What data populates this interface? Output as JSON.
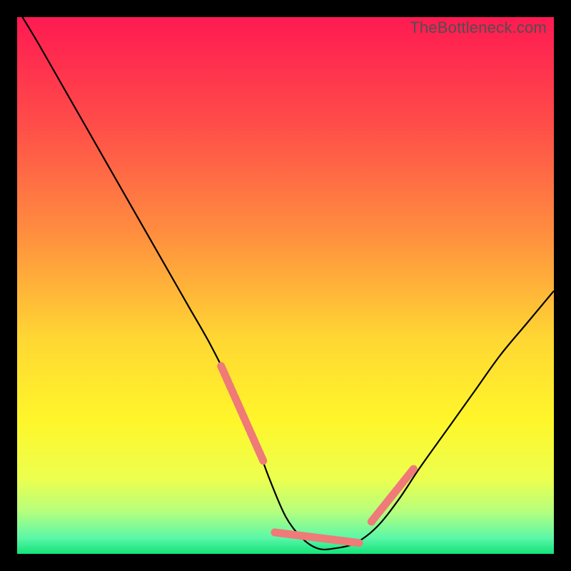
{
  "watermark": "TheBottleneck.com",
  "chart_data": {
    "type": "line",
    "title": "",
    "xlabel": "",
    "ylabel": "",
    "xlim": [
      0,
      100
    ],
    "ylim": [
      0,
      100
    ],
    "grid": false,
    "legend": false,
    "gradient_stops": [
      {
        "offset": 0.0,
        "color": "#ff1a52"
      },
      {
        "offset": 0.2,
        "color": "#ff4d49"
      },
      {
        "offset": 0.4,
        "color": "#ff8d3f"
      },
      {
        "offset": 0.6,
        "color": "#ffd733"
      },
      {
        "offset": 0.75,
        "color": "#fff62a"
      },
      {
        "offset": 0.86,
        "color": "#ecff4e"
      },
      {
        "offset": 0.92,
        "color": "#b7ff7c"
      },
      {
        "offset": 0.97,
        "color": "#5cf7a8"
      },
      {
        "offset": 1.0,
        "color": "#12e37a"
      }
    ],
    "series": [
      {
        "name": "bottleneck-curve",
        "color": "#000000",
        "x": [
          1,
          4,
          8,
          12,
          16,
          20,
          24,
          28,
          32,
          36,
          40,
          44,
          47,
          50,
          53,
          56,
          59,
          63,
          67,
          71,
          75,
          80,
          85,
          90,
          95,
          100
        ],
        "y": [
          100,
          95,
          88,
          81,
          74,
          67,
          60,
          53,
          46,
          39,
          31,
          22,
          14,
          7,
          3,
          1,
          1,
          2,
          5,
          10,
          16,
          23,
          30,
          37,
          43,
          49
        ]
      },
      {
        "name": "highlight-segments",
        "color": "#ef7a78",
        "style": "thick-dash",
        "segments": [
          {
            "x": [
              38,
              46
            ],
            "y": [
              35,
              17
            ]
          },
          {
            "x": [
              48,
              64
            ],
            "y": [
              4,
              2
            ]
          },
          {
            "x": [
              66,
              74
            ],
            "y": [
              6,
              16
            ]
          }
        ]
      }
    ]
  }
}
